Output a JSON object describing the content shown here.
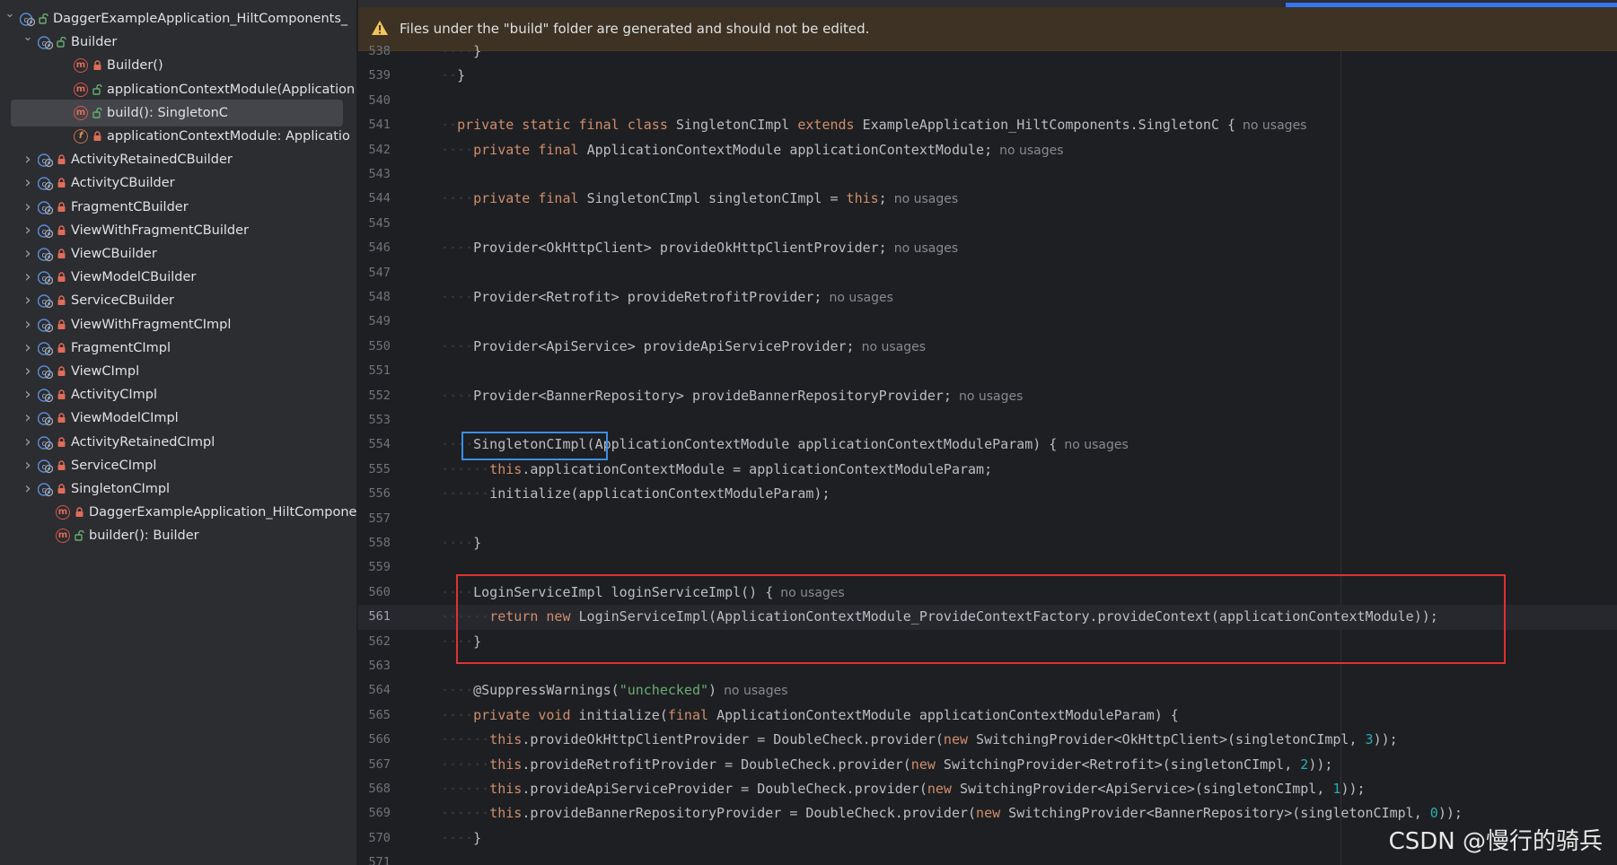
{
  "structure_tree": {
    "items": [
      {
        "indent": 0,
        "chevron": "expanded",
        "icon": "class-icon",
        "access": "public",
        "label": "DaggerExampleApplication_HiltComponents_"
      },
      {
        "indent": 1,
        "chevron": "expanded",
        "icon": "class-icon",
        "access": "public",
        "label": "Builder"
      },
      {
        "indent": 2,
        "chevron": "none",
        "icon": "method-icon",
        "access": "private",
        "label": "Builder()"
      },
      {
        "indent": 2,
        "chevron": "none",
        "icon": "method-icon",
        "access": "public",
        "label": "applicationContextModule(Application"
      },
      {
        "indent": 2,
        "chevron": "none",
        "icon": "method-icon",
        "access": "public",
        "label": "build(): SingletonC",
        "selected": true
      },
      {
        "indent": 2,
        "chevron": "none",
        "icon": "field-icon",
        "access": "private",
        "label": "applicationContextModule: Applicatio"
      },
      {
        "indent": 1,
        "chevron": "collapsed",
        "icon": "class-icon",
        "access": "private",
        "label": "ActivityRetainedCBuilder"
      },
      {
        "indent": 1,
        "chevron": "collapsed",
        "icon": "class-icon",
        "access": "private",
        "label": "ActivityCBuilder"
      },
      {
        "indent": 1,
        "chevron": "collapsed",
        "icon": "class-icon",
        "access": "private",
        "label": "FragmentCBuilder"
      },
      {
        "indent": 1,
        "chevron": "collapsed",
        "icon": "class-icon",
        "access": "private",
        "label": "ViewWithFragmentCBuilder"
      },
      {
        "indent": 1,
        "chevron": "collapsed",
        "icon": "class-icon",
        "access": "private",
        "label": "ViewCBuilder"
      },
      {
        "indent": 1,
        "chevron": "collapsed",
        "icon": "class-icon",
        "access": "private",
        "label": "ViewModelCBuilder"
      },
      {
        "indent": 1,
        "chevron": "collapsed",
        "icon": "class-icon",
        "access": "private",
        "label": "ServiceCBuilder"
      },
      {
        "indent": 1,
        "chevron": "collapsed",
        "icon": "class-icon",
        "access": "private",
        "label": "ViewWithFragmentCImpl"
      },
      {
        "indent": 1,
        "chevron": "collapsed",
        "icon": "class-icon",
        "access": "private",
        "label": "FragmentCImpl"
      },
      {
        "indent": 1,
        "chevron": "collapsed",
        "icon": "class-icon",
        "access": "private",
        "label": "ViewCImpl"
      },
      {
        "indent": 1,
        "chevron": "collapsed",
        "icon": "class-icon",
        "access": "private",
        "label": "ActivityCImpl"
      },
      {
        "indent": 1,
        "chevron": "collapsed",
        "icon": "class-icon",
        "access": "private",
        "label": "ViewModelCImpl"
      },
      {
        "indent": 1,
        "chevron": "collapsed",
        "icon": "class-icon",
        "access": "private",
        "label": "ActivityRetainedCImpl"
      },
      {
        "indent": 1,
        "chevron": "collapsed",
        "icon": "class-icon",
        "access": "private",
        "label": "ServiceCImpl"
      },
      {
        "indent": 1,
        "chevron": "collapsed",
        "icon": "class-icon",
        "access": "private",
        "label": "SingletonCImpl"
      },
      {
        "indent": 1,
        "chevron": "none",
        "icon": "method-icon",
        "access": "private",
        "label": "DaggerExampleApplication_HiltComponer"
      },
      {
        "indent": 1,
        "chevron": "none",
        "icon": "method-icon",
        "access": "public",
        "label": "builder(): Builder"
      }
    ]
  },
  "editor": {
    "notice": "Files under the \"build\" folder are generated and should not be edited.",
    "current_line": "561",
    "lines": [
      {
        "num": "538",
        "segs": [
          {
            "t": "dot",
            "v": "····"
          },
          {
            "t": "plain",
            "v": "}"
          }
        ]
      },
      {
        "num": "539",
        "segs": [
          {
            "t": "dot",
            "v": "··"
          },
          {
            "t": "plain",
            "v": "}"
          }
        ]
      },
      {
        "num": "540",
        "segs": []
      },
      {
        "num": "541",
        "segs": [
          {
            "t": "dot",
            "v": "··"
          },
          {
            "t": "kw",
            "v": "private static final class "
          },
          {
            "t": "plain",
            "v": "SingletonCImpl "
          },
          {
            "t": "kw",
            "v": "extends "
          },
          {
            "t": "plain",
            "v": "ExampleApplication_HiltComponents.SingletonC {"
          },
          {
            "t": "hint",
            "v": "no usages"
          }
        ]
      },
      {
        "num": "542",
        "segs": [
          {
            "t": "dot",
            "v": "····"
          },
          {
            "t": "kw",
            "v": "private final "
          },
          {
            "t": "plain",
            "v": "ApplicationContextModule applicationContextModule;"
          },
          {
            "t": "hint",
            "v": "no usages"
          }
        ]
      },
      {
        "num": "543",
        "segs": []
      },
      {
        "num": "544",
        "segs": [
          {
            "t": "dot",
            "v": "····"
          },
          {
            "t": "kw",
            "v": "private final "
          },
          {
            "t": "plain",
            "v": "SingletonCImpl singletonCImpl = "
          },
          {
            "t": "kw",
            "v": "this"
          },
          {
            "t": "plain",
            "v": ";"
          },
          {
            "t": "hint",
            "v": "no usages"
          }
        ]
      },
      {
        "num": "545",
        "segs": []
      },
      {
        "num": "546",
        "segs": [
          {
            "t": "dot",
            "v": "····"
          },
          {
            "t": "plain",
            "v": "Provider<OkHttpClient> provideOkHttpClientProvider;"
          },
          {
            "t": "hint",
            "v": "no usages"
          }
        ]
      },
      {
        "num": "547",
        "segs": []
      },
      {
        "num": "548",
        "segs": [
          {
            "t": "dot",
            "v": "····"
          },
          {
            "t": "plain",
            "v": "Provider<Retrofit> provideRetrofitProvider;"
          },
          {
            "t": "hint",
            "v": "no usages"
          }
        ]
      },
      {
        "num": "549",
        "segs": []
      },
      {
        "num": "550",
        "segs": [
          {
            "t": "dot",
            "v": "····"
          },
          {
            "t": "plain",
            "v": "Provider<ApiService> provideApiServiceProvider;"
          },
          {
            "t": "hint",
            "v": "no usages"
          }
        ]
      },
      {
        "num": "551",
        "segs": []
      },
      {
        "num": "552",
        "segs": [
          {
            "t": "dot",
            "v": "····"
          },
          {
            "t": "plain",
            "v": "Provider<BannerRepository> provideBannerRepositoryProvider;"
          },
          {
            "t": "hint",
            "v": "no usages"
          }
        ]
      },
      {
        "num": "553",
        "segs": []
      },
      {
        "num": "554",
        "segs": [
          {
            "t": "dot",
            "v": "····"
          },
          {
            "t": "plain",
            "v": "SingletonCImpl(ApplicationContextModule applicationContextModuleParam) {"
          },
          {
            "t": "hint",
            "v": "no usages"
          }
        ]
      },
      {
        "num": "555",
        "segs": [
          {
            "t": "dot",
            "v": "······"
          },
          {
            "t": "kw",
            "v": "this"
          },
          {
            "t": "plain",
            "v": ".applicationContextModule = applicationContextModuleParam;"
          }
        ]
      },
      {
        "num": "556",
        "segs": [
          {
            "t": "dot",
            "v": "······"
          },
          {
            "t": "plain",
            "v": "initialize(applicationContextModuleParam);"
          }
        ]
      },
      {
        "num": "557",
        "segs": []
      },
      {
        "num": "558",
        "segs": [
          {
            "t": "dot",
            "v": "····"
          },
          {
            "t": "plain",
            "v": "}"
          }
        ]
      },
      {
        "num": "559",
        "segs": []
      },
      {
        "num": "560",
        "segs": [
          {
            "t": "dot",
            "v": "····"
          },
          {
            "t": "plain",
            "v": "LoginServiceImpl loginServiceImpl() {"
          },
          {
            "t": "hint",
            "v": "no usages"
          }
        ]
      },
      {
        "num": "561",
        "segs": [
          {
            "t": "dot",
            "v": "······"
          },
          {
            "t": "kw",
            "v": "return new "
          },
          {
            "t": "plain",
            "v": "LoginServiceImpl(ApplicationContextModule_ProvideContextFactory.provideContext(applicationContextModule));"
          }
        ]
      },
      {
        "num": "562",
        "segs": [
          {
            "t": "dot",
            "v": "····"
          },
          {
            "t": "plain",
            "v": "}"
          }
        ]
      },
      {
        "num": "563",
        "segs": []
      },
      {
        "num": "564",
        "segs": [
          {
            "t": "dot",
            "v": "····"
          },
          {
            "t": "plain",
            "v": "@SuppressWarnings("
          },
          {
            "t": "str",
            "v": "\"unchecked\""
          },
          {
            "t": "plain",
            "v": ")"
          },
          {
            "t": "hint",
            "v": "no usages"
          }
        ]
      },
      {
        "num": "565",
        "segs": [
          {
            "t": "dot",
            "v": "····"
          },
          {
            "t": "kw",
            "v": "private void "
          },
          {
            "t": "plain",
            "v": "initialize("
          },
          {
            "t": "kw",
            "v": "final "
          },
          {
            "t": "plain",
            "v": "ApplicationContextModule applicationContextModuleParam) {"
          }
        ]
      },
      {
        "num": "566",
        "segs": [
          {
            "t": "dot",
            "v": "······"
          },
          {
            "t": "kw",
            "v": "this"
          },
          {
            "t": "plain",
            "v": ".provideOkHttpClientProvider = DoubleCheck.provider("
          },
          {
            "t": "kw",
            "v": "new "
          },
          {
            "t": "plain",
            "v": "SwitchingProvider<OkHttpClient>(singletonCImpl, "
          },
          {
            "t": "num",
            "v": "3"
          },
          {
            "t": "plain",
            "v": "));"
          }
        ]
      },
      {
        "num": "567",
        "segs": [
          {
            "t": "dot",
            "v": "······"
          },
          {
            "t": "kw",
            "v": "this"
          },
          {
            "t": "plain",
            "v": ".provideRetrofitProvider = DoubleCheck.provider("
          },
          {
            "t": "kw",
            "v": "new "
          },
          {
            "t": "plain",
            "v": "SwitchingProvider<Retrofit>(singletonCImpl, "
          },
          {
            "t": "num",
            "v": "2"
          },
          {
            "t": "plain",
            "v": "));"
          }
        ]
      },
      {
        "num": "568",
        "segs": [
          {
            "t": "dot",
            "v": "······"
          },
          {
            "t": "kw",
            "v": "this"
          },
          {
            "t": "plain",
            "v": ".provideApiServiceProvider = DoubleCheck.provider("
          },
          {
            "t": "kw",
            "v": "new "
          },
          {
            "t": "plain",
            "v": "SwitchingProvider<ApiService>(singletonCImpl, "
          },
          {
            "t": "num",
            "v": "1"
          },
          {
            "t": "plain",
            "v": "));"
          }
        ]
      },
      {
        "num": "569",
        "segs": [
          {
            "t": "dot",
            "v": "······"
          },
          {
            "t": "kw",
            "v": "this"
          },
          {
            "t": "plain",
            "v": ".provideBannerRepositoryProvider = DoubleCheck.provider("
          },
          {
            "t": "kw",
            "v": "new "
          },
          {
            "t": "plain",
            "v": "SwitchingProvider<BannerRepository>(singletonCImpl, "
          },
          {
            "t": "num",
            "v": "0"
          },
          {
            "t": "plain",
            "v": "));"
          }
        ]
      },
      {
        "num": "570",
        "segs": [
          {
            "t": "dot",
            "v": "····"
          },
          {
            "t": "plain",
            "v": "}"
          }
        ]
      },
      {
        "num": "571",
        "segs": []
      }
    ]
  },
  "watermark": "CSDN @慢行的骑兵",
  "colors": {
    "panel_bg": "#2b2d30",
    "editor_bg": "#1e1f22",
    "keyword": "#cf8e6d",
    "string": "#6aab73",
    "number": "#2aacb8",
    "annotation_blue": "#3a8ee6",
    "annotation_red": "#e03131",
    "accent": "#3574f0"
  }
}
